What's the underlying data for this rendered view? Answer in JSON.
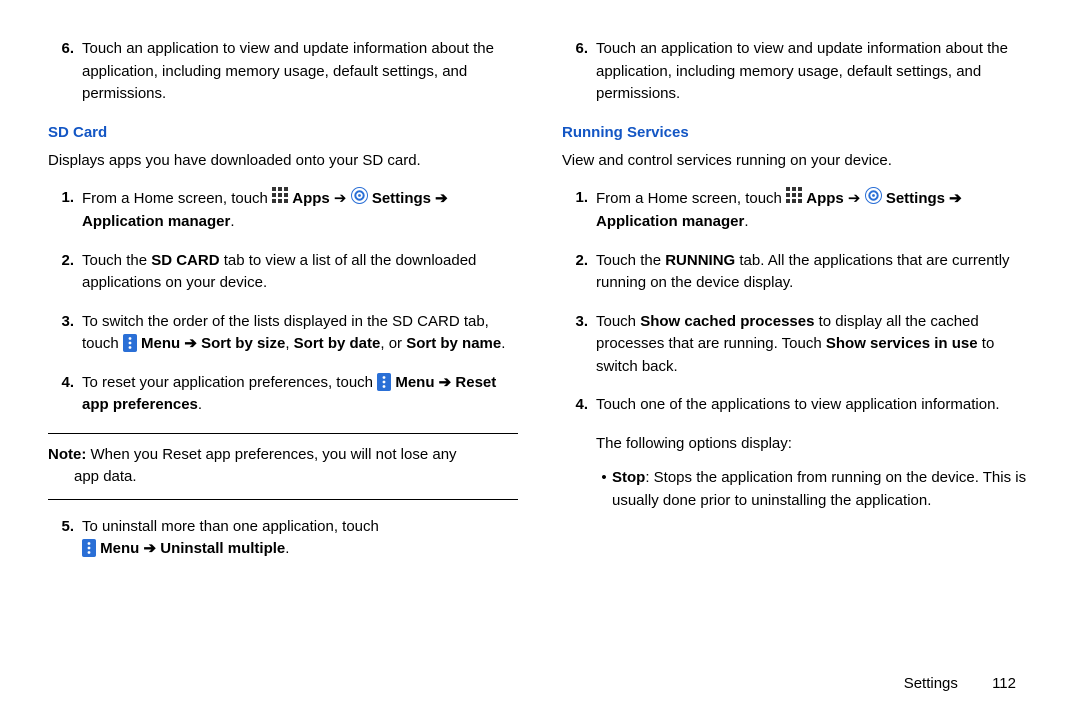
{
  "left": {
    "top_item": {
      "n": "6.",
      "text": "Touch an application to view and update information about the application, including memory usage, default settings, and permissions."
    },
    "heading": "SD Card",
    "intro": "Displays apps you have downloaded onto your SD card.",
    "i1": {
      "n": "1.",
      "pre": "From a Home screen, touch ",
      "apps": "Apps",
      "arrow1": " ➔ ",
      "settings": "Settings",
      "arrow2": " ➔ Application manager",
      "post": "."
    },
    "i2": {
      "n": "2.",
      "pre": "Touch the ",
      "bold": "SD CARD",
      "post": " tab to view a list of all the downloaded applications on your device."
    },
    "i3": {
      "n": "3.",
      "line1_pre": "To switch the order of the lists displayed in the SD CARD tab, touch ",
      "menu": "Menu",
      "arrow": " ➔ Sort by size",
      "mid": ", ",
      "b2": "Sort by date",
      "mid2": ", or ",
      "b3": "Sort by name",
      "post": "."
    },
    "i4": {
      "n": "4.",
      "pre": "To reset your application preferences, touch ",
      "menu": "Menu",
      "arrow": " ➔ Reset app preferences",
      "post": "."
    },
    "note": {
      "label": "Note:",
      "text": " When you Reset app preferences, you will not lose any",
      "cont": "app data."
    },
    "i5": {
      "n": "5.",
      "pre": "To uninstall more than one application, touch",
      "menu": "Menu",
      "arrow": " ➔ Uninstall multiple",
      "post": "."
    }
  },
  "right": {
    "top_item": {
      "n": "6.",
      "text": "Touch an application to view and update information about the application, including memory usage, default settings, and permissions."
    },
    "heading": "Running Services",
    "intro": "View and control services running on your device.",
    "i1": {
      "n": "1.",
      "pre": "From a Home screen, touch ",
      "apps": "Apps",
      "arrow1": " ➔ ",
      "settings": "Settings",
      "arrow2": " ➔ Application manager",
      "post": "."
    },
    "i2": {
      "n": "2.",
      "pre": "Touch the ",
      "bold": "RUNNING",
      "post": " tab. All the applications that are currently running on the device display."
    },
    "i3": {
      "n": "3.",
      "pre": "Touch ",
      "b1": "Show cached processes",
      "mid": " to display all the cached processes that are running. Touch ",
      "b2": "Show services in use",
      "post": " to switch back."
    },
    "i4": {
      "n": "4.",
      "text": "Touch one of the applications to view application information."
    },
    "follow": "The following options display:",
    "bullet": {
      "b": "Stop",
      "text": ": Stops the application from running on the device. This is usually done prior to uninstalling the application."
    }
  },
  "footer": {
    "section": "Settings",
    "page": "112"
  }
}
